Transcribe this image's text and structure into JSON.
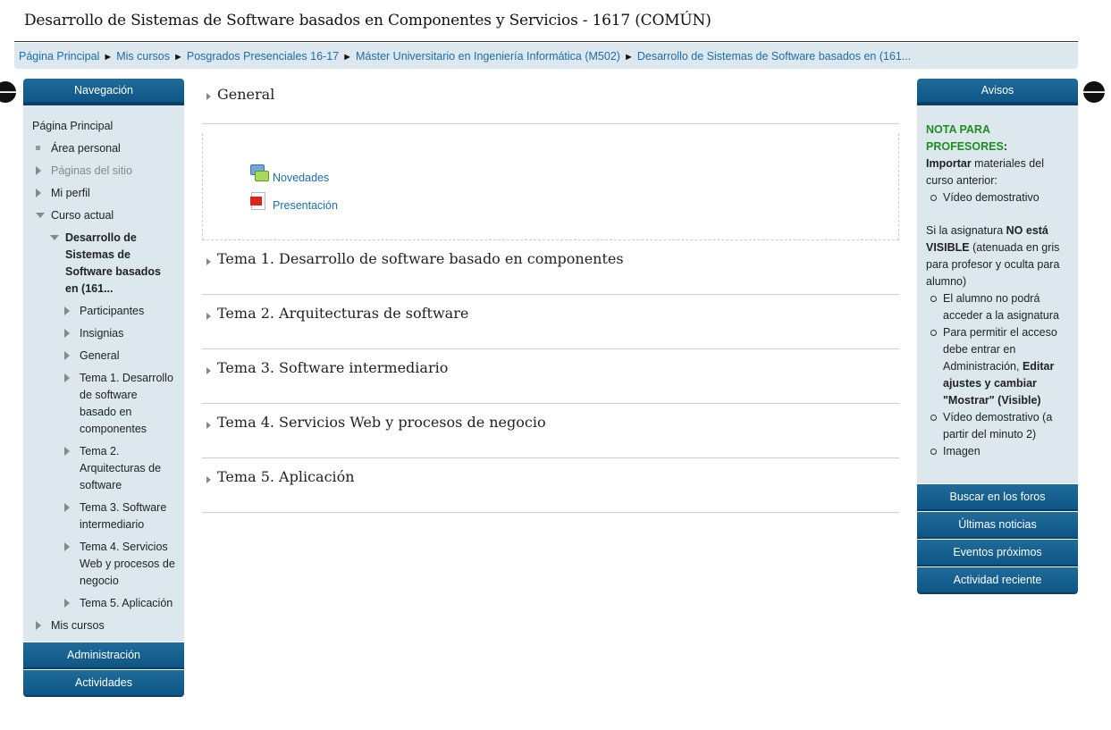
{
  "page_title": "Desarrollo de Sistemas de Software basados en Componentes y Servicios - 1617 (COMÚN)",
  "breadcrumb": [
    "Página Principal",
    "Mis cursos",
    "Posgrados Presenciales 16-17",
    "Máster Universitario en Ingeniería Informática (M502)",
    "Desarrollo de Sistemas de Software basados en (161..."
  ],
  "breadcrumb_separator": "►",
  "dock": {
    "left_icon": "arrow-left-icon",
    "right_icon": "arrow-right-icon",
    "left_glyph": "🡐",
    "right_glyph": "🡒"
  },
  "navigation": {
    "header": "Navegación",
    "home": "Página Principal",
    "area_personal": "Área personal",
    "paginas_sitio": "Páginas del sitio",
    "mi_perfil": "Mi perfil",
    "curso_actual": "Curso actual",
    "course_name": "Desarrollo de Sistemas de Software basados en (161...",
    "course_items": [
      "Participantes",
      "Insignias",
      "General",
      "Tema 1. Desarrollo de software basado en componentes",
      "Tema 2. Arquitecturas de software",
      "Tema 3. Software intermediario",
      "Tema 4. Servicios Web y procesos de negocio",
      "Tema 5. Aplicación"
    ],
    "mis_cursos": "Mis cursos"
  },
  "left_blocks": [
    "Administración",
    "Actividades"
  ],
  "sections": {
    "general": "General",
    "activities": [
      {
        "label": "Novedades",
        "icon": "forum-icon"
      },
      {
        "label": "Presentación",
        "icon": "pdf-icon"
      }
    ],
    "temas": [
      "Tema 1. Desarrollo de software basado en componentes",
      "Tema 2. Arquitecturas de software",
      "Tema 3. Software intermediario",
      "Tema 4. Servicios Web y procesos de negocio",
      "Tema 5. Aplicación"
    ]
  },
  "avisos": {
    "header": "Avisos",
    "nota_title": "NOTA PARA PROFESORES",
    "nota_colon": ":",
    "importar_bold": "Importar",
    "importar_rest": " materiales del curso anterior:",
    "video1": "Vídeo demostrativo",
    "si_text": "Si la asignatura ",
    "no_visible_bold": "NO está VISIBLE",
    "si_rest": " (atenuada en gris para profesor y oculta para alumno)",
    "bullet1": "El alumno no podrá acceder a la asignatura",
    "bullet2_text": "Para permitir el acceso debe entrar en Administración, ",
    "bullet2_bold": "Editar ajustes y cambiar \"Mostrar\" (Visible)",
    "bullet3": "Vídeo demostrativo (a partir del minuto 2)",
    "bullet4": "Imagen"
  },
  "right_blocks": [
    "Buscar en los foros",
    "Últimas noticias",
    "Eventos próximos",
    "Actividad reciente"
  ],
  "colors": {
    "header_blue": "#0e5686",
    "block_bg": "#dce7ee",
    "link": "#1a6fa8",
    "green": "#1e8f1e"
  }
}
